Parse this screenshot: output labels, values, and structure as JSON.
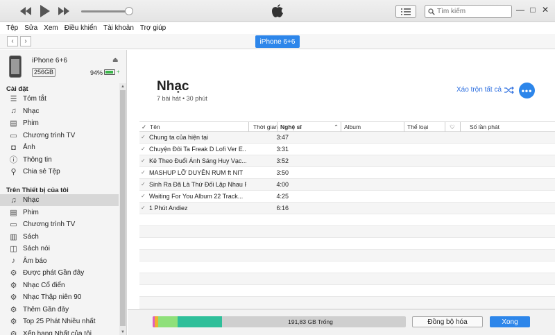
{
  "menu": [
    "Tệp",
    "Sửa",
    "Xem",
    "Điều khiển",
    "Tài khoản",
    "Trợ giúp"
  ],
  "search": {
    "placeholder": "Tìm kiếm"
  },
  "device_tab": "iPhone 6+6",
  "device": {
    "name": "iPhone 6+6",
    "capacity": "256GB",
    "battery_pct": "94%",
    "battery_level": 0.94
  },
  "sidebar": {
    "settings_header": "Cài đặt",
    "settings_items": [
      {
        "label": "Tóm tắt",
        "icon": "summary-icon"
      },
      {
        "label": "Nhạc",
        "icon": "music-note-icon"
      },
      {
        "label": "Phim",
        "icon": "film-icon"
      },
      {
        "label": "Chương trình TV",
        "icon": "tv-icon"
      },
      {
        "label": "Ảnh",
        "icon": "camera-icon"
      },
      {
        "label": "Thông tin",
        "icon": "info-icon"
      },
      {
        "label": "Chia sẻ Tệp",
        "icon": "apps-icon"
      }
    ],
    "ondevice_header": "Trên Thiết bị của tôi",
    "ondevice_items": [
      {
        "label": "Nhạc",
        "icon": "music-note-icon",
        "active": true
      },
      {
        "label": "Phim",
        "icon": "film-icon"
      },
      {
        "label": "Chương trình TV",
        "icon": "tv-icon"
      },
      {
        "label": "Sách",
        "icon": "book-icon"
      },
      {
        "label": "Sách nói",
        "icon": "audiobook-icon"
      },
      {
        "label": "Âm báo",
        "icon": "bell-icon"
      },
      {
        "label": "Được phát Gần đây",
        "icon": "gear-icon"
      },
      {
        "label": "Nhạc Cổ điển",
        "icon": "gear-icon"
      },
      {
        "label": "Nhạc Thập niên 90",
        "icon": "gear-icon"
      },
      {
        "label": "Thêm Gần đây",
        "icon": "gear-icon"
      },
      {
        "label": "Top 25 Phát Nhiều nhất",
        "icon": "gear-icon"
      },
      {
        "label": "Xếp hạng Nhất của tôi",
        "icon": "gear-icon"
      }
    ]
  },
  "main": {
    "title": "Nhạc",
    "subtitle": "7 bài hát • 30 phút",
    "shuffle_label": "Xáo trộn tất cả",
    "more_label": "•••"
  },
  "table": {
    "headers": {
      "name": "Tên",
      "time": "Thời gian",
      "artist": "Nghệ sĩ",
      "album": "Album",
      "genre": "Thể loại",
      "plays": "Số lần phát"
    },
    "rows": [
      {
        "name": "Chung ta của hiện tại",
        "time": "3:47"
      },
      {
        "name": "Chuyện Đôi Ta Freak D Lofi Ver  E...",
        "time": "3:31"
      },
      {
        "name": "Kẻ Theo Đuổi Ánh Sáng  Huy Vạc...",
        "time": "3:52"
      },
      {
        "name": "MASHUP LỠ DUYÊN  RUM ft NIT",
        "time": "3:50"
      },
      {
        "name": "Sinh Ra Đã Là Thứ Đối Lập Nhau F...",
        "time": "4:00"
      },
      {
        "name": "Waiting For You Album 22  Track...",
        "time": "4:25"
      },
      {
        "name": "1 Phút  Andiez",
        "time": "6:16"
      }
    ]
  },
  "footer": {
    "storage_free": "191,83 GB Trống",
    "sync_label": "Đồng bộ hóa",
    "done_label": "Xong"
  },
  "colors": {
    "accent": "#2d86ea",
    "storage_segments": [
      "#e060c0",
      "#f0b030",
      "#8fe07a",
      "#2fbf9a"
    ]
  }
}
